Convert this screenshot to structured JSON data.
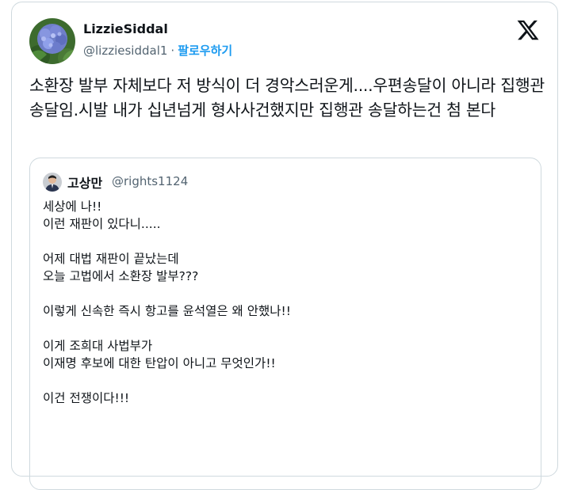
{
  "author": {
    "display_name": "LizzieSiddal",
    "handle": "@lizziesiddal1",
    "separator": "·",
    "follow_label": "팔로우하기",
    "avatar_icon": "hydrangea-flower-avatar"
  },
  "brand": {
    "logo_icon": "x-logo-icon"
  },
  "tweet": {
    "text": "소환장 발부 자체보다 저 방식이 더 경악스러운게....우편송달이 아니라 집행관 송달임.시발 내가 십년넘게 형사사건했지만 집행관 송달하는건 첨 본다"
  },
  "quote": {
    "display_name": "고상만",
    "handle": "@rights1124",
    "lines": [
      "세상에 나!!",
      "이런 재판이 있다니.....",
      "",
      "어제 대법 재판이 끝났는데",
      "오늘 고법에서 소환장 발부???",
      "",
      "이렇게 신속한 즉시 항고를 윤석열은 왜 안했나!!",
      "",
      "이게 조희대 사법부가",
      "이재명 후보에 대한 탄압이 아니고 무엇인가!!",
      "",
      "이건 전쟁이다!!!"
    ]
  },
  "colors": {
    "text": "#0f1419",
    "secondary": "#536471",
    "accent": "#1d9bf0",
    "border": "#cfd9de"
  }
}
